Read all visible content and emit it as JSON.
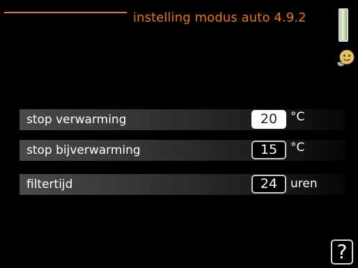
{
  "header": {
    "title": "instelling modus auto 4.9.2",
    "accent_color": "#e8761a",
    "menu_icon": "thermometer-face-icon"
  },
  "settings": [
    {
      "label": "stop verwarming",
      "value": "20",
      "unit": "°C",
      "selected": true
    },
    {
      "label": "stop bijverwarming",
      "value": "15",
      "unit": "°C",
      "selected": false
    },
    {
      "label": "filtertijd",
      "value": "24",
      "unit": "uren",
      "selected": false
    }
  ],
  "help": {
    "label": "?"
  }
}
